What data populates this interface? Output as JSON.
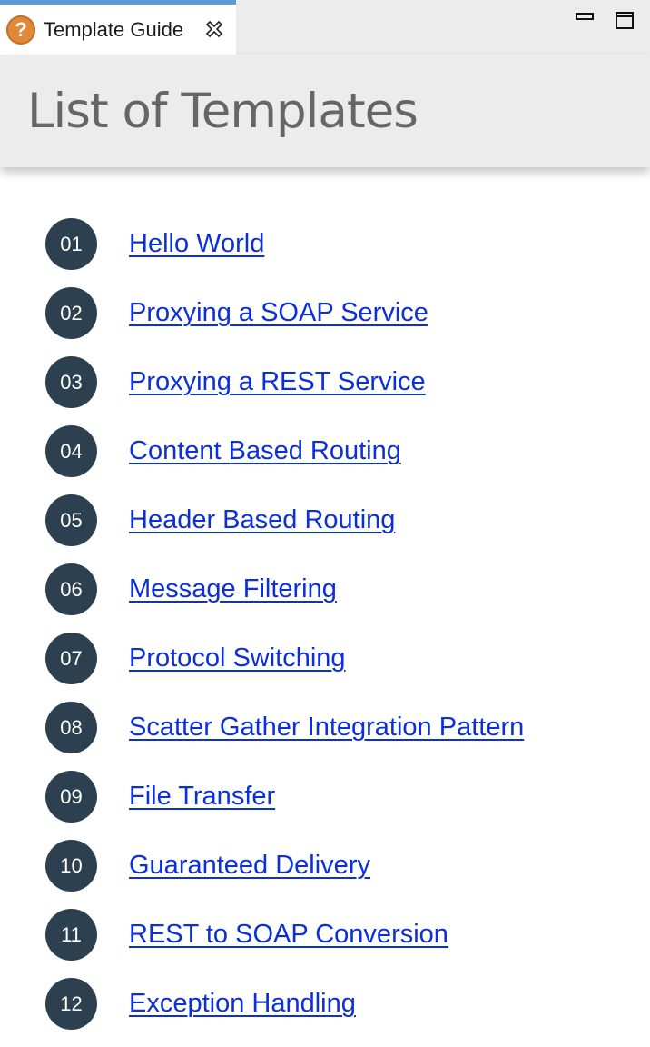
{
  "tab": {
    "label": "Template Guide",
    "icon": "help-icon",
    "icon_glyph": "?",
    "icon_color": "#e0893a",
    "active_indicator_color": "#5b9bd5"
  },
  "header": {
    "title": "List of Templates"
  },
  "colors": {
    "badge": "#2d4050",
    "link": "#0b2fd9",
    "title": "#666666",
    "header_bg": "#ececec"
  },
  "templates": [
    {
      "number": "01",
      "label": "Hello World"
    },
    {
      "number": "02",
      "label": "Proxying a SOAP Service"
    },
    {
      "number": "03",
      "label": "Proxying a REST Service"
    },
    {
      "number": "04",
      "label": "Content Based Routing"
    },
    {
      "number": "05",
      "label": "Header Based Routing"
    },
    {
      "number": "06",
      "label": "Message Filtering"
    },
    {
      "number": "07",
      "label": "Protocol Switching"
    },
    {
      "number": "08",
      "label": "Scatter Gather Integration Pattern"
    },
    {
      "number": "09",
      "label": "File Transfer"
    },
    {
      "number": "10",
      "label": "Guaranteed Delivery"
    },
    {
      "number": "11",
      "label": "REST to SOAP Conversion"
    },
    {
      "number": "12",
      "label": "Exception Handling"
    }
  ]
}
